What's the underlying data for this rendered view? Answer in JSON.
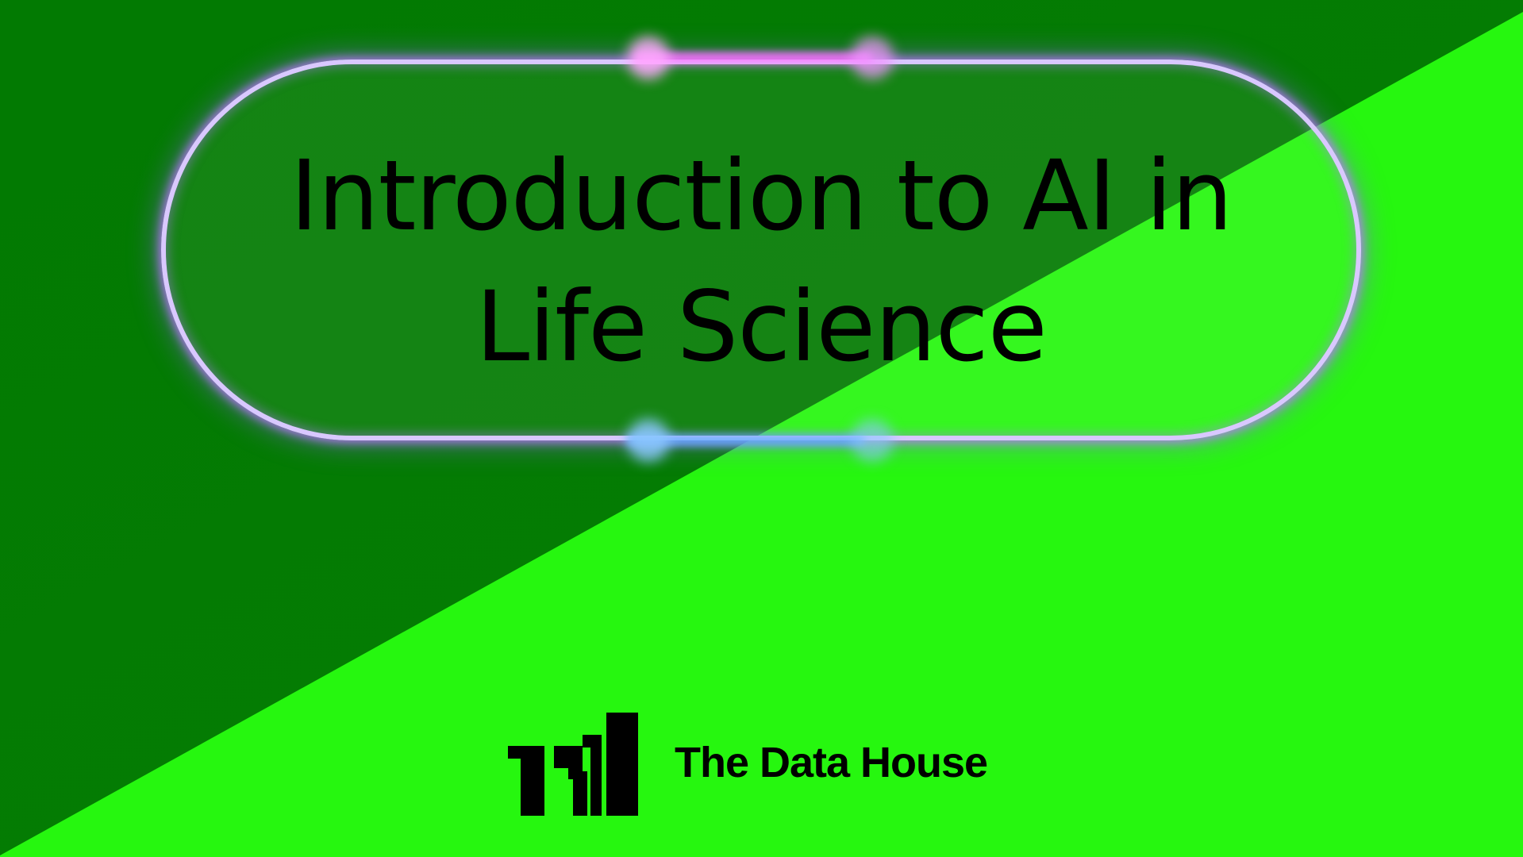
{
  "slide": {
    "title_line1": "Introduction to AI in",
    "title_line2": "Life Science"
  },
  "brand": {
    "name": "The Data House",
    "logo_icon": "data-house-logo-icon"
  },
  "colors": {
    "dark_green": "#027a02",
    "bright_green": "#26f70f",
    "neon_purple": "#b77cff",
    "neon_blue": "#6fb4ff",
    "text": "#000000"
  }
}
